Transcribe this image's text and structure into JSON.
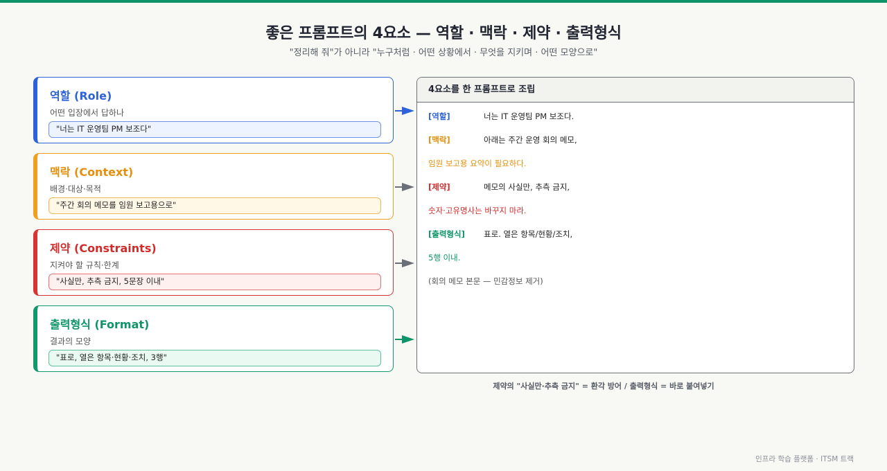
{
  "header": {
    "title": "좋은 프롬프트의 4요소 — 역할 · 맥락 · 제약 · 출력형식",
    "subtitle": "\"정리해 줘\"가 아니라 \"누구처럼 · 어떤 상황에서 · 무엇을 지키며 · 어떤 모양으로\""
  },
  "cards": [
    {
      "title": "역할 (Role)",
      "desc": "어떤 입장에서 답하나",
      "example": "\"너는 IT 운영팀 PM 보조다\""
    },
    {
      "title": "맥락 (Context)",
      "desc": "배경·대상·목적",
      "example": "\"주간 회의 메모를 임원 보고용으로\""
    },
    {
      "title": "제약 (Constraints)",
      "desc": "지켜야 할 규칙·한계",
      "example": "\"사실만, 추측 금지, 5문장 이내\""
    },
    {
      "title": "출력형식 (Format)",
      "desc": "결과의 모양",
      "example": "\"표로, 열은 항목·현황·조치, 3행\""
    }
  ],
  "panel": {
    "heading": "4요소를 한 프롬프트로 조립",
    "lines": [
      {
        "tag": "[역할]",
        "text": "너는 IT 운영팀 PM 보조다."
      },
      {
        "tag": "[맥락]",
        "text": "아래는 주간 운영 회의 메모,"
      },
      {
        "text": "임원 보고용 요약이 필요하다."
      },
      {
        "tag": "[제약]",
        "text": "메모의 사실만, 추측 금지,"
      },
      {
        "text": "숫자·고유명사는 바꾸지 마라."
      },
      {
        "tag": "[출력형식]",
        "text": "표로. 열은 항목/현황/조치,"
      },
      {
        "text": "5행 이내."
      },
      {
        "text": "(회의 메모 본문 — 민감정보 제거)"
      }
    ]
  },
  "caption": "제약의 \"사실만·추측 금지\" = 환각 방어 / 출력형식 = 바로 붙여넣기",
  "footer": "인프라 학습 플랫폼 · ITSM 트랙",
  "colors": {
    "role": "#2e62d9",
    "context": "#e58f0c",
    "constraints": "#d22b2b",
    "format": "#0e9468",
    "accent_bar": "#0e9468"
  }
}
